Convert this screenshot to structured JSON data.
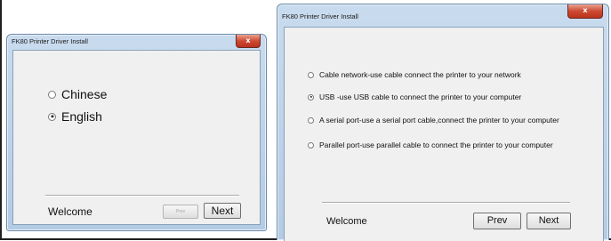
{
  "left_window": {
    "title": "FK80 Printer Driver Install",
    "close_glyph": "x",
    "options": [
      {
        "label": "Chinese",
        "selected": false
      },
      {
        "label": "English",
        "selected": true
      }
    ],
    "status": "Welcome",
    "prev_label": "Prev",
    "next_label": "Next"
  },
  "right_window": {
    "title": "FK80 Printer Driver Install",
    "close_glyph": "x",
    "options": [
      {
        "label": "Cable network-use cable connect the printer to your network",
        "selected": false
      },
      {
        "label": "USB -use USB cable to connect the printer to your computer",
        "selected": true
      },
      {
        "label": "A serial port-use a serial port cable,connect the printer to your computer",
        "selected": false
      },
      {
        "label": "Parallel port-use parallel cable to connect the printer to your computer",
        "selected": false
      }
    ],
    "status": "Welcome",
    "prev_label": "Prev",
    "next_label": "Next"
  }
}
